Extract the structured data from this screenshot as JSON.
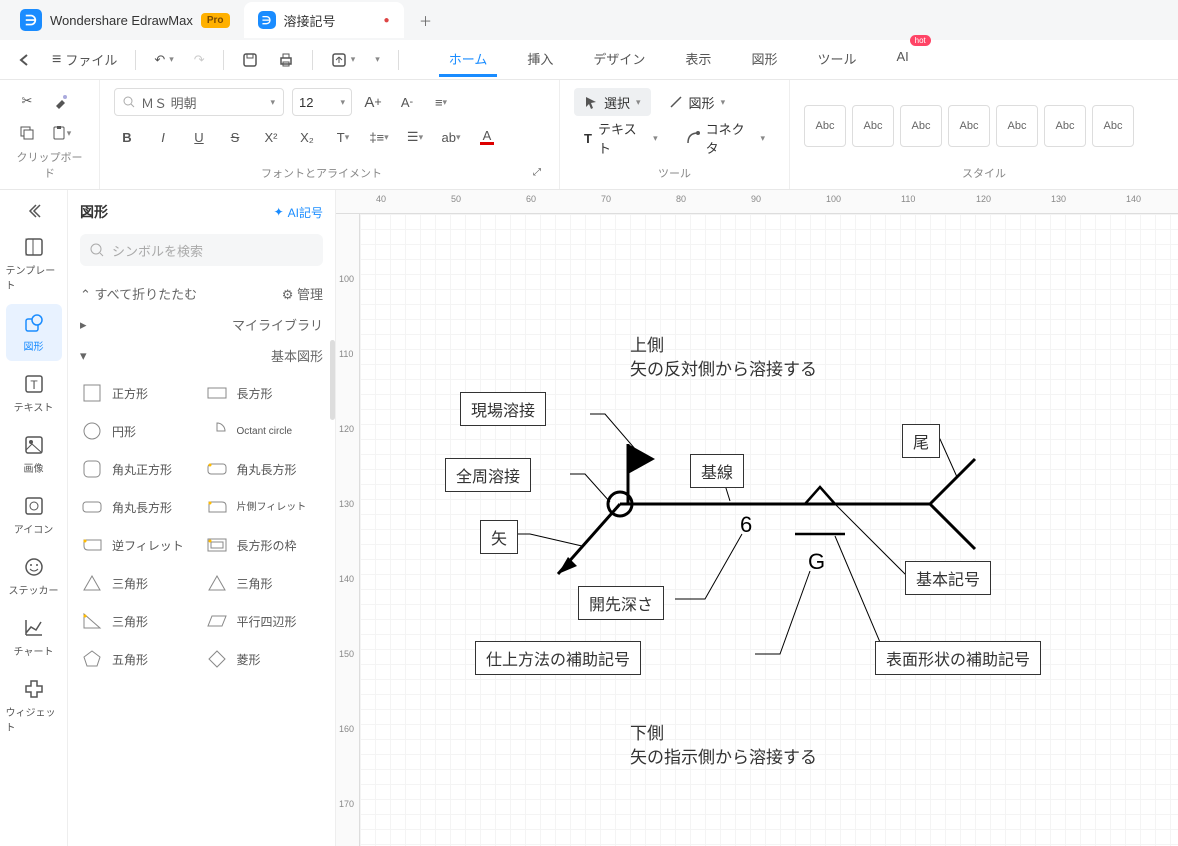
{
  "title_tab": {
    "app_name": "Wondershare EdrawMax",
    "pro": "Pro",
    "doc": "溶接記号"
  },
  "file_menu": "ファイル",
  "nav": [
    "ホーム",
    "挿入",
    "デザイン",
    "表示",
    "図形",
    "ツール",
    "AI"
  ],
  "nav_active": 0,
  "hot": "hot",
  "ribbon": {
    "clipboard": "クリップボード",
    "font_align": "フォントとアライメント",
    "tools": "ツール",
    "style": "スタイル",
    "font": "ＭＳ 明朝",
    "size": "12",
    "select": "選択",
    "shape": "図形",
    "text": "テキスト",
    "connector": "コネクタ",
    "abc": "Abc"
  },
  "rail": {
    "template": "テンプレート",
    "shape": "図形",
    "text": "テキスト",
    "image": "画像",
    "icon": "アイコン",
    "sticker": "ステッカー",
    "chart": "チャート",
    "widget": "ウィジェット"
  },
  "panel": {
    "title": "図形",
    "ai": "AI記号",
    "search_placeholder": "シンボルを検索",
    "collapse": "すべて折りたたむ",
    "manage": "管理",
    "mylib": "マイライブラリ",
    "basic": "基本図形",
    "shapes": [
      "正方形",
      "長方形",
      "円形",
      "Octant circle",
      "角丸正方形",
      "角丸長方形",
      "角丸長方形",
      "片側フィレット",
      "逆フィレット",
      "長方形の枠",
      "三角形",
      "三角形",
      "三角形",
      "平行四辺形",
      "五角形",
      "菱形"
    ]
  },
  "ruler_h": [
    "40",
    "50",
    "60",
    "70",
    "80",
    "90",
    "100",
    "110",
    "120",
    "130",
    "140"
  ],
  "ruler_v": [
    "100",
    "110",
    "120",
    "130",
    "140",
    "150",
    "160",
    "170"
  ],
  "diagram": {
    "top1": "上側",
    "top2": "矢の反対側から溶接する",
    "bottom1": "下側",
    "bottom2": "矢の指示側から溶接する",
    "field": "現場溶接",
    "allround": "全周溶接",
    "arrow": "矢",
    "baseline": "基線",
    "tail": "尾",
    "depth": "開先深さ",
    "six": "6",
    "g": "G",
    "finish": "仕上方法の補助記号",
    "basic_sym": "基本記号",
    "surface": "表面形状の補助記号"
  }
}
